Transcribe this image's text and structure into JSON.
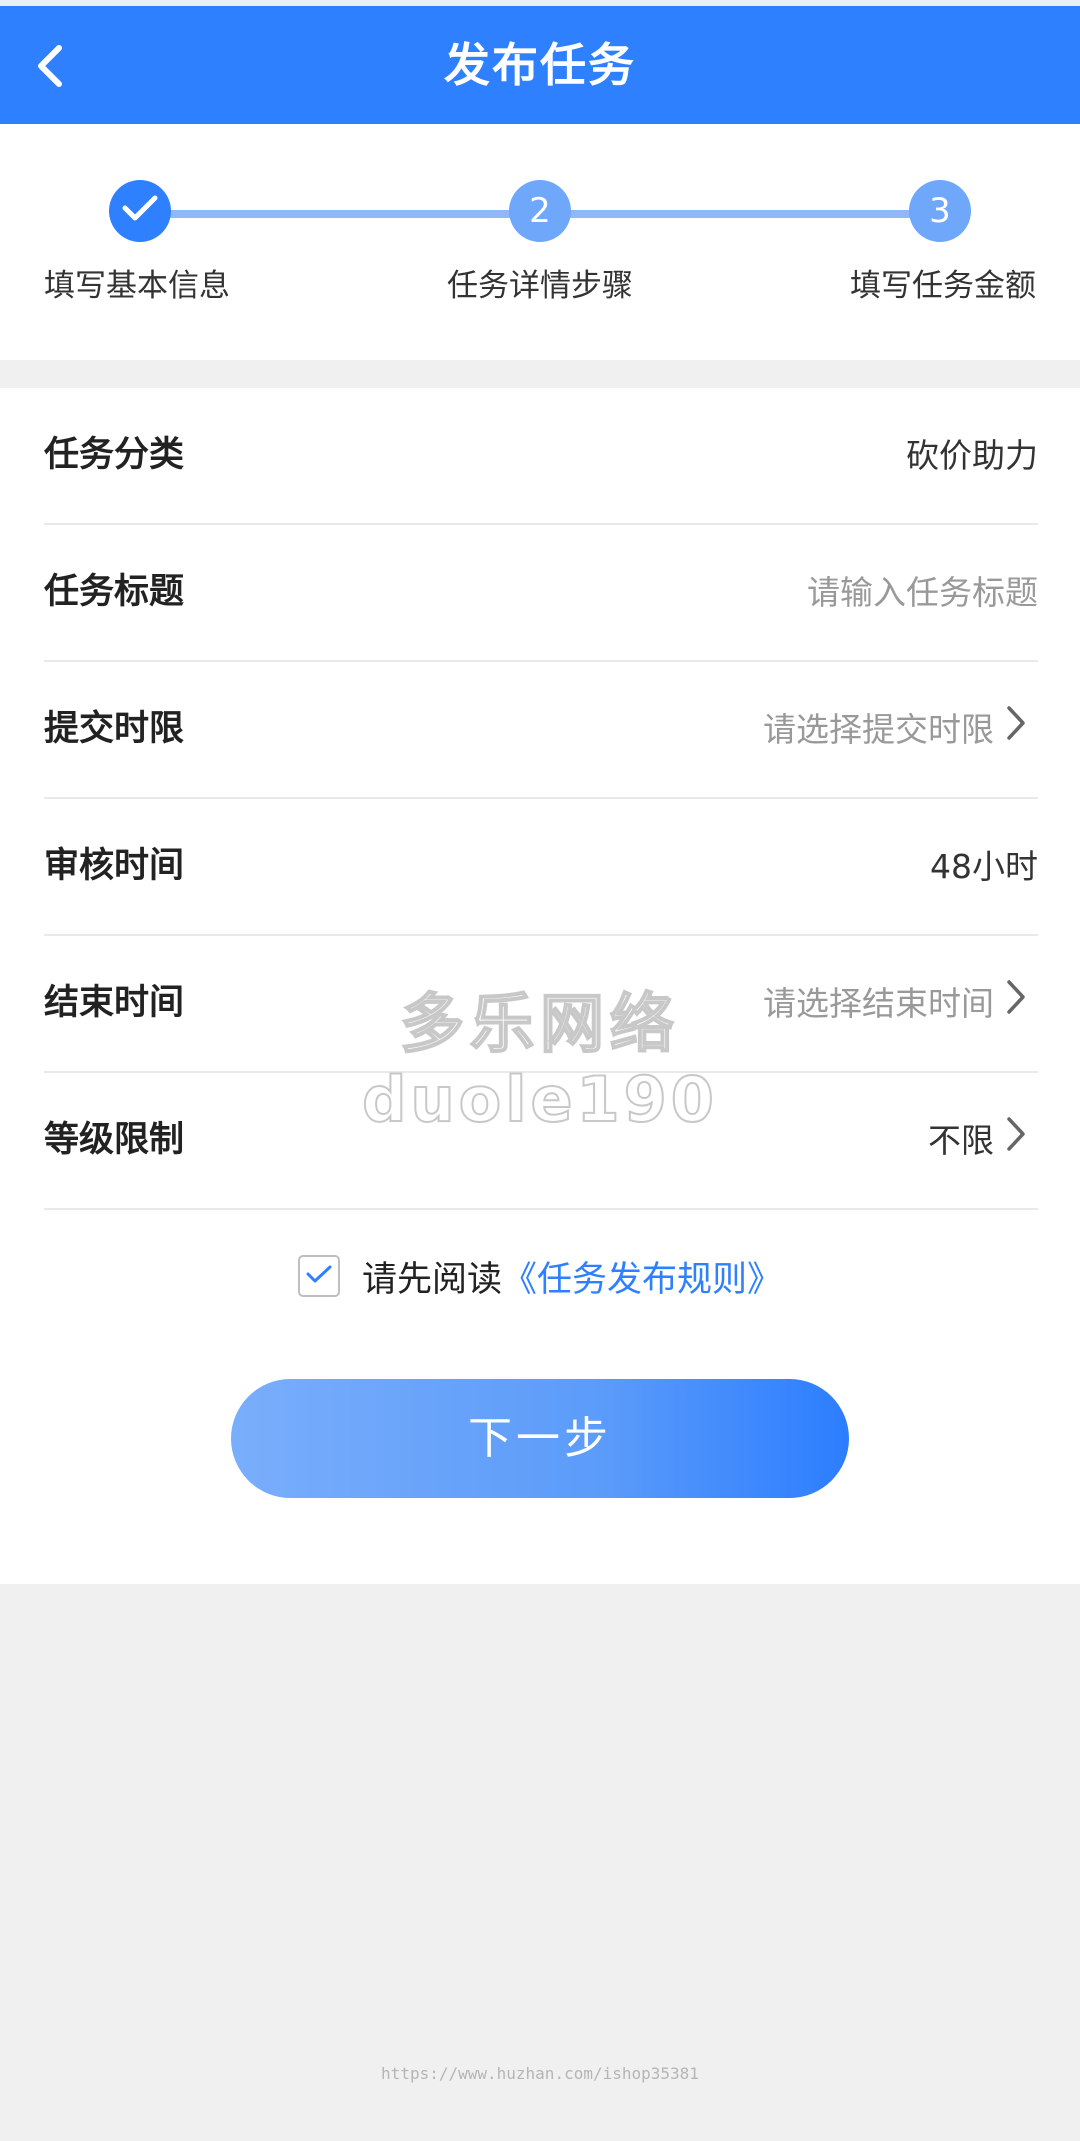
{
  "header": {
    "title": "发布任务"
  },
  "steps": {
    "items": [
      {
        "number": "",
        "label": "填写基本信息",
        "status": "done"
      },
      {
        "number": "2",
        "label": "任务详情步骤",
        "status": "pending"
      },
      {
        "number": "3",
        "label": "填写任务金额",
        "status": "pending"
      }
    ]
  },
  "form": {
    "category": {
      "label": "任务分类",
      "value": "砍价助力"
    },
    "title": {
      "label": "任务标题",
      "placeholder": "请输入任务标题",
      "value": ""
    },
    "submit_limit": {
      "label": "提交时限",
      "placeholder": "请选择提交时限"
    },
    "review_time": {
      "label": "审核时间",
      "value": "48小时"
    },
    "end_time": {
      "label": "结束时间",
      "placeholder": "请选择结束时间"
    },
    "level_limit": {
      "label": "等级限制",
      "value": "不限"
    }
  },
  "agreement": {
    "checked": true,
    "prefix": "请先阅读",
    "link": "《任务发布规则》"
  },
  "next_button": {
    "label": "下一步"
  },
  "watermark": {
    "line1": "多乐网络",
    "line2": "duole190"
  },
  "footer": {
    "url": "https://www.huzhan.com/ishop35381"
  },
  "colors": {
    "primary": "#2f80ff",
    "step_line": "#8eb8f6",
    "placeholder": "#999999",
    "background": "#f0f0f0"
  }
}
